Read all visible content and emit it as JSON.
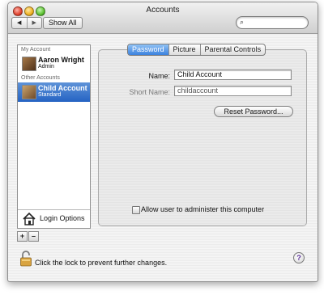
{
  "window": {
    "title": "Accounts"
  },
  "toolbar": {
    "back_glyph": "◀",
    "forward_glyph": "▶",
    "show_all_label": "Show All",
    "search_placeholder": "",
    "search_glyph": "⌕"
  },
  "sidebar": {
    "my_account_header": "My Account",
    "other_accounts_header": "Other Accounts",
    "accounts": [
      {
        "name": "Aaron Wright",
        "type": "Admin",
        "selected": false,
        "avatar": "user-photo-icon"
      },
      {
        "name": "Child Account",
        "type": "Standard",
        "selected": true,
        "avatar": "user-photo-icon"
      }
    ],
    "login_options_label": "Login Options",
    "add_label": "+",
    "remove_label": "–"
  },
  "tabs": [
    {
      "label": "Password",
      "active": true
    },
    {
      "label": "Picture",
      "active": false
    },
    {
      "label": "Parental Controls",
      "active": false
    }
  ],
  "form": {
    "name_label": "Name:",
    "name_value": "Child Account",
    "short_name_label": "Short Name:",
    "short_name_value": "childaccount",
    "reset_password_label": "Reset Password...",
    "admin_checkbox_label": "Allow user to administer this computer",
    "admin_checked": false
  },
  "footer": {
    "lock_text": "Click the lock to prevent further changes.",
    "help_label": "?"
  },
  "colors": {
    "selection": "#2563c3",
    "panel_border": "#aaaaaa"
  }
}
